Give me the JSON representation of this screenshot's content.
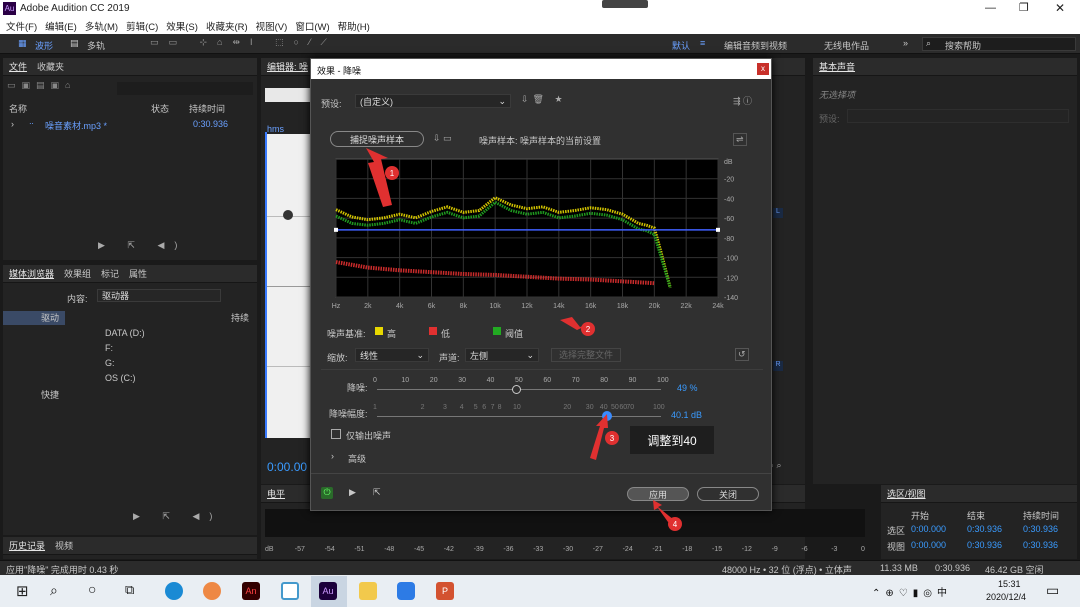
{
  "app": {
    "title": "Adobe Audition CC 2019",
    "logo": "Au"
  },
  "menu": [
    "文件(F)",
    "编辑(E)",
    "多轨(M)",
    "剪辑(C)",
    "效果(S)",
    "收藏夹(R)",
    "视图(V)",
    "窗口(W)",
    "帮助(H)"
  ],
  "toolbar": {
    "waveform": "波形",
    "multitrack": "多轨",
    "workspaces": [
      "默认",
      "编辑音频到视频",
      "无线电作品"
    ],
    "search_placeholder": "搜索帮助"
  },
  "files_panel": {
    "tabs": [
      "文件",
      "收藏夹"
    ],
    "columns": [
      "名称",
      "状态",
      "持续时间"
    ],
    "file": {
      "name": "噪音素材.mp3 *",
      "duration": "0:30.936"
    }
  },
  "media_panel": {
    "tabs": [
      "媒体浏览器",
      "效果组",
      "标记",
      "属性"
    ],
    "content_label": "内容:",
    "content_value": "驱动器",
    "name_col": "名称",
    "duration_col": "持续",
    "tree": [
      "驱动",
      "DATA (D:)",
      "F:",
      "G:",
      "OS (C:)",
      "快捷"
    ]
  },
  "history_panel": {
    "tabs": [
      "历史记录",
      "视频"
    ]
  },
  "editor": {
    "tab": "编辑器: 噪",
    "ruler": "hms",
    "time": "0:00.00"
  },
  "levels": {
    "title": "电平",
    "scale": [
      "dB",
      "-57",
      "-54",
      "-51",
      "-48",
      "-45",
      "-42",
      "-39",
      "-36",
      "-33",
      "-30",
      "-27",
      "-24",
      "-21",
      "-18",
      "-15",
      "-12",
      "-9",
      "-6",
      "-3",
      "0"
    ]
  },
  "essential_sound": {
    "title": "基本声音",
    "no_selection": "无选择项",
    "preset_label": "预设:"
  },
  "selection_view": {
    "title": "选区/视图",
    "cols": [
      "开始",
      "结束",
      "持续时间"
    ],
    "rows": [
      {
        "label": "选区",
        "start": "0:00.000",
        "end": "0:30.936",
        "dur": "0:30.936"
      },
      {
        "label": "视图",
        "start": "0:00.000",
        "end": "0:30.936",
        "dur": "0:30.936"
      }
    ]
  },
  "status": {
    "left": "应用\"降噪\" 完成用时 0.43 秒",
    "right": "48000 Hz • 32 位 (浮点) • 立体声",
    "size": "11.33 MB",
    "dur": "0:30.936",
    "free": "46.42 GB 空闲"
  },
  "dialog": {
    "title": "效果 - 降噪",
    "close": "x",
    "preset_label": "预设:",
    "preset_value": "(自定义)",
    "capture_button": "捕捉噪声样本",
    "noise_sample_text": "噪声样本: 噪声样本的当前设置",
    "noise_floor_label": "噪声基准:",
    "legend": [
      {
        "label": "高",
        "color": "#e8d800"
      },
      {
        "label": "低",
        "color": "#e03030"
      },
      {
        "label": "阈值",
        "color": "#22aa22"
      }
    ],
    "scale_label": "缩放:",
    "scale_value": "线性",
    "channel_label": "声道:",
    "channel_value": "左侧",
    "select_file": "选择完整文件",
    "reduction_label": "降噪:",
    "reduction_ticks": [
      "0",
      "10",
      "20",
      "30",
      "40",
      "50",
      "60",
      "70",
      "80",
      "90",
      "100"
    ],
    "reduction_value": "49 %",
    "reduction_fraction": 0.49,
    "amount_label": "降噪幅度:",
    "amount_ticks": [
      "1",
      "2",
      "3",
      "4",
      "5",
      "6",
      "7",
      "8",
      "10",
      "20",
      "30",
      "40",
      "50",
      "60",
      "70",
      "100"
    ],
    "amount_value": "40.1 dB",
    "amount_fraction": 0.81,
    "output_noise_only": "仅输出噪声",
    "advanced": "高级",
    "apply": "应用",
    "close_button": "关闭",
    "annotation_text": "调整到40",
    "markers": [
      "1",
      "2",
      "3",
      "4"
    ]
  },
  "chart_data": {
    "type": "line",
    "x_ticks": [
      "Hz",
      "2k",
      "4k",
      "6k",
      "8k",
      "10k",
      "12k",
      "14k",
      "16k",
      "18k",
      "20k",
      "22k",
      "24k"
    ],
    "y_ticks": [
      "dB",
      "-20",
      "-40",
      "-60",
      "-80",
      "-100",
      "-120",
      "-140"
    ],
    "ylim": [
      -150,
      0
    ],
    "xlim": [
      0,
      24000
    ],
    "series": [
      {
        "name": "高",
        "color": "#e8d800",
        "x": [
          0,
          1000,
          2000,
          3000,
          4000,
          5000,
          6000,
          7000,
          8000,
          9000,
          10000,
          11000,
          12000,
          13000,
          14000,
          15000,
          16000,
          17000,
          18000,
          19000,
          19500,
          20000,
          20400,
          21000
        ],
        "values": [
          -55,
          -63,
          -66,
          -64,
          -60,
          -64,
          -57,
          -52,
          -58,
          -56,
          -42,
          -50,
          -54,
          -52,
          -58,
          -56,
          -53,
          -55,
          -60,
          -70,
          -72,
          -75,
          -100,
          -140
        ]
      },
      {
        "name": "阈值",
        "color": "#22aa22",
        "x": [
          0,
          1000,
          2000,
          3000,
          4000,
          5000,
          6000,
          7000,
          8000,
          9000,
          10000,
          11000,
          12000,
          13000,
          14000,
          15000,
          16000,
          17000,
          18000,
          19000,
          19500,
          20000,
          20400,
          21000
        ],
        "values": [
          -62,
          -70,
          -72,
          -70,
          -66,
          -70,
          -63,
          -58,
          -64,
          -62,
          -47,
          -56,
          -60,
          -58,
          -64,
          -62,
          -59,
          -61,
          -66,
          -76,
          -78,
          -82,
          -105,
          -140
        ]
      },
      {
        "name": "低",
        "color": "#e03030",
        "x": [
          0,
          2000,
          4000,
          6000,
          8000,
          10000,
          12000,
          14000,
          16000,
          18000,
          20000
        ],
        "values": [
          -112,
          -118,
          -121,
          -123,
          -125,
          -126,
          -128,
          -130,
          -131,
          -133,
          -135
        ]
      },
      {
        "name": "threshold-line",
        "color": "#4060ff",
        "x": [
          0,
          20000,
          24000
        ],
        "values": [
          -77,
          -77,
          -77
        ]
      }
    ]
  }
}
